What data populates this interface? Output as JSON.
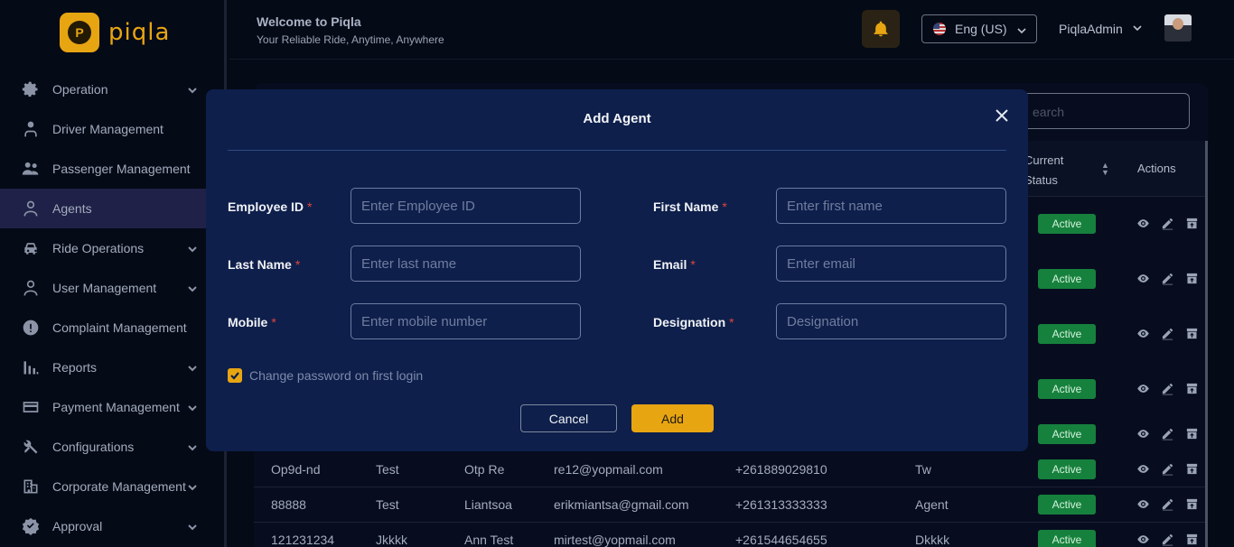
{
  "app": {
    "logo_text": "piqla",
    "logo_mark": "P"
  },
  "header": {
    "welcome_title": "Welcome to Piqla",
    "welcome_subtitle": "Your Reliable Ride, Anytime, Anywhere",
    "language": "Eng (US)",
    "user_name": "PiqlaAdmin"
  },
  "sidebar": {
    "items": [
      {
        "label": "Operation",
        "icon": "gear-icon",
        "has_chevron": true,
        "active": false
      },
      {
        "label": "Driver Management",
        "icon": "driver-icon",
        "has_chevron": false,
        "active": false
      },
      {
        "label": "Passenger Management",
        "icon": "passengers-icon",
        "has_chevron": false,
        "active": false
      },
      {
        "label": "Agents",
        "icon": "user-icon",
        "has_chevron": false,
        "active": true
      },
      {
        "label": "Ride Operations",
        "icon": "car-icon",
        "has_chevron": true,
        "active": false
      },
      {
        "label": "User Management",
        "icon": "user-icon",
        "has_chevron": true,
        "active": false
      },
      {
        "label": "Complaint Management",
        "icon": "alert-icon",
        "has_chevron": false,
        "active": false
      },
      {
        "label": "Reports",
        "icon": "bar-chart-icon",
        "has_chevron": true,
        "active": false
      },
      {
        "label": "Payment Management",
        "icon": "card-icon",
        "has_chevron": true,
        "active": false
      },
      {
        "label": "Configurations",
        "icon": "tools-icon",
        "has_chevron": true,
        "active": false
      },
      {
        "label": "Corporate Management",
        "icon": "building-icon",
        "has_chevron": true,
        "active": false
      },
      {
        "label": "Approval",
        "icon": "badge-check-icon",
        "has_chevron": true,
        "active": false
      }
    ]
  },
  "table": {
    "search_placeholder": "earch",
    "col_status_line1": "Current",
    "col_status_line2": "Status",
    "col_actions": "Actions",
    "hidden_row_statuses": [
      "Active",
      "Active",
      "Active",
      "Active",
      "Active"
    ],
    "rows": [
      {
        "id": "Op9d-nd",
        "first": "Test",
        "last": "Otp Re",
        "email": "re12@yopmail.com",
        "mobile": "+261889029810",
        "designation": "Tw",
        "status": "Active"
      },
      {
        "id": "88888",
        "first": "Test",
        "last": "Liantsoa",
        "email": "erikmiantsa@gmail.com",
        "mobile": "+261313333333",
        "designation": "Agent",
        "status": "Active"
      },
      {
        "id": "121231234",
        "first": "Jkkkk",
        "last": "Ann Test",
        "email": "mirtest@yopmail.com",
        "mobile": "+261544654655",
        "designation": "Dkkkk",
        "status": "Active"
      }
    ]
  },
  "modal": {
    "title": "Add Agent",
    "employee_id_label": "Employee ID",
    "employee_id_placeholder": "Enter Employee ID",
    "first_name_label": "First Name",
    "first_name_placeholder": "Enter first name",
    "last_name_label": "Last Name",
    "last_name_placeholder": "Enter last name",
    "email_label": "Email",
    "email_placeholder": "Enter email",
    "mobile_label": "Mobile",
    "mobile_placeholder": "Enter mobile number",
    "designation_label": "Designation",
    "designation_placeholder": "Designation",
    "required_mark": "*",
    "checkbox_label": "Change password on first login",
    "checkbox_checked": true,
    "cancel_label": "Cancel",
    "add_label": "Add"
  },
  "colors": {
    "accent": "#e8a512",
    "modal_bg": "#0e1f4b",
    "active_badge": "#16813d",
    "required": "#e0453c"
  }
}
